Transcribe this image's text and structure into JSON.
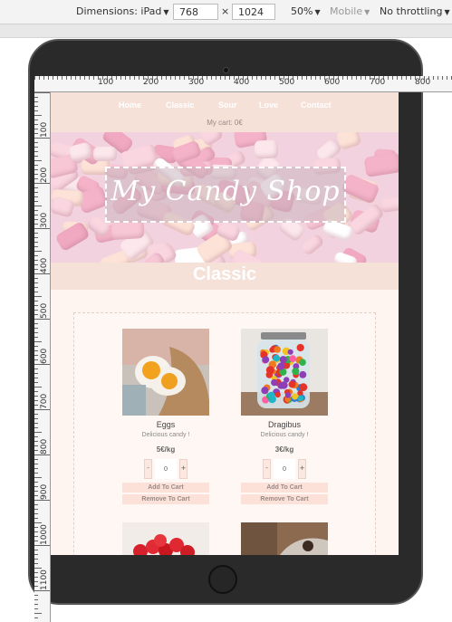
{
  "devtools": {
    "dimensions_label": "Dimensions: iPad",
    "width_value": "768",
    "times": "×",
    "height_value": "1024",
    "zoom_label": "50%",
    "mobile_label": "Mobile",
    "throttle_label": "No throttling"
  },
  "ruler": {
    "horizontal": [
      "100",
      "200",
      "300",
      "400",
      "500",
      "600",
      "700",
      "800"
    ],
    "vertical": [
      "100",
      "200",
      "300",
      "400",
      "500",
      "600",
      "700",
      "800",
      "900",
      "1000",
      "1100"
    ]
  },
  "site": {
    "nav": [
      "Home",
      "Classic",
      "Sour",
      "Love",
      "Contact"
    ],
    "cart": "My cart: 0€",
    "hero_title": "My Candy Shop",
    "section_title": "Classic",
    "products": [
      {
        "name": "Eggs",
        "description": "Delicious candy !",
        "price": "5€/kg",
        "quantity": "0",
        "minus": "-",
        "plus": "+",
        "add": "Add To Cart",
        "remove": "Remove To Cart"
      },
      {
        "name": "Dragibus",
        "description": "Delicious candy !",
        "price": "3€/kg",
        "quantity": "0",
        "minus": "-",
        "plus": "+",
        "add": "Add To Cart",
        "remove": "Remove To Cart"
      }
    ]
  },
  "colors": {
    "nav_bg": "#f6e1d9",
    "page_bg": "#fff5f0",
    "button_bg": "#fbe1d8",
    "tablet_frame": "#2a2a2a"
  },
  "icons": [
    "dropdown-caret-icon",
    "camera-icon",
    "home-button-icon"
  ]
}
